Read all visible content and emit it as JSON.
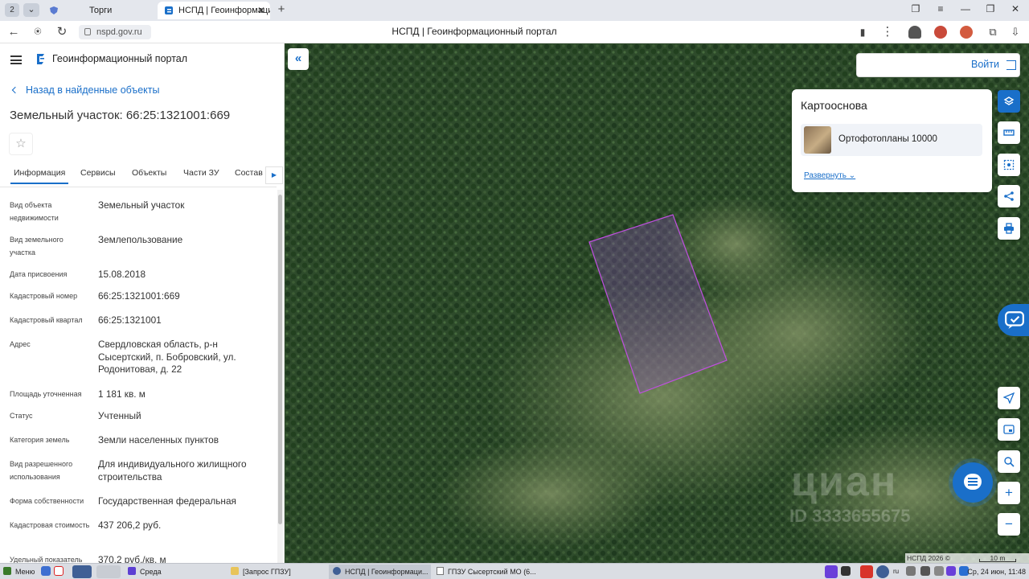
{
  "browser": {
    "tab_count": "2",
    "tabs": [
      {
        "label": "Торги"
      },
      {
        "label": "НСПД | Геоинформационн"
      }
    ],
    "url": "nspd.gov.ru",
    "page_title": "НСПД | Геоинформационный портал"
  },
  "panel": {
    "portal_name": "Геоинформационный портал",
    "back_link": "Назад в найденные объекты",
    "object_title": "Земельный участок: 66:25:1321001:669",
    "tabs": [
      "Информация",
      "Сервисы",
      "Объекты",
      "Части ЗУ",
      "Состав"
    ],
    "rows": [
      {
        "key": "Вид объекта недвижимости",
        "value": "Земельный участок"
      },
      {
        "key": "Вид земельного участка",
        "value": "Землепользование"
      },
      {
        "key": "Дата присвоения",
        "value": "15.08.2018"
      },
      {
        "key": "Кадастровый номер",
        "value": "66:25:1321001:669"
      },
      {
        "key": "Кадастровый квартал",
        "value": "66:25:1321001"
      },
      {
        "key": "Адрес",
        "value": "Свердловская область, р-н Сысертский, п. Бобровский, ул. Родонитовая, д. 22"
      },
      {
        "key": "Площадь уточненная",
        "value": "1 181 кв. м"
      },
      {
        "key": "Статус",
        "value": "Учтенный"
      },
      {
        "key": "Категория земель",
        "value": "Земли населенных пунктов"
      },
      {
        "key": "Вид разрешенного использования",
        "value": "Для индивидуального жилищного строительства"
      },
      {
        "key": "Форма собственности",
        "value": "Государственная федеральная"
      },
      {
        "key": "Кадастровая стоимость",
        "value": "437 206,2 руб."
      },
      {
        "key": "Удельный показатель",
        "value": "370,2 руб./кв. м"
      }
    ]
  },
  "map": {
    "login_label": "Войти",
    "basemap_title": "Картооснова",
    "basemap_layer": "Ортофотопланы 10000",
    "expand_label": "Развернуть",
    "watermark_logo": "циан",
    "watermark_id": "ID 3333655675",
    "attribution": "НСПД 2026 ©",
    "scale_label": "10 m",
    "parcel_color": "#b23fd9"
  },
  "taskbar": {
    "menu_label": "Меню",
    "items": [
      "Среда",
      "[Запрос ГПЗУ]",
      "НСПД | Геоинформаци...",
      "ГПЗУ Сысертский МО (6..."
    ],
    "lang": "ru",
    "clock": "Ср, 24 июн, 11:48"
  },
  "colors": {
    "accent": "#1a6fc9",
    "forest": "#2f4c2c"
  }
}
